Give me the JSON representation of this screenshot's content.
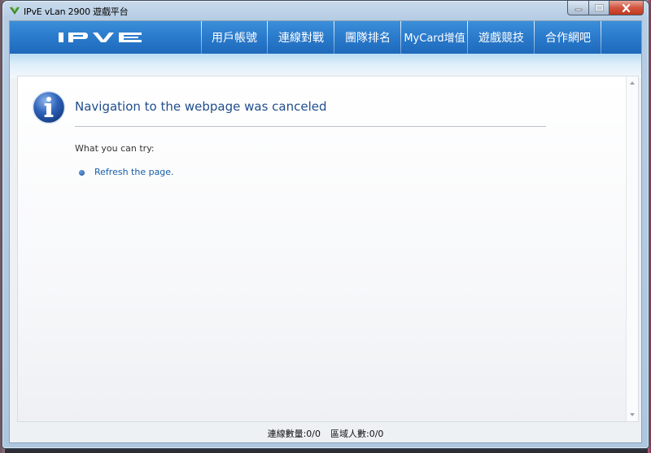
{
  "window": {
    "title": "IPvE vLan 2900 遊戲平台"
  },
  "header": {
    "logo_text": "IPVE",
    "nav": [
      {
        "label": "用戶帳號"
      },
      {
        "label": "連線對戰"
      },
      {
        "label": "團隊排名"
      },
      {
        "label": "MyCard增值"
      },
      {
        "label": "遊戲競技"
      },
      {
        "label": "合作網吧"
      }
    ]
  },
  "browser": {
    "error_title": "Navigation to the webpage was canceled",
    "try_label": "What you can try:",
    "suggestions": [
      {
        "label": "Refresh the page."
      }
    ]
  },
  "status": {
    "connections": "連線數量:0/0",
    "region_users": "區域人數:0/0"
  },
  "colors": {
    "header_blue": "#2a7acb",
    "link_blue": "#1a5ea8",
    "title_blue": "#1f4e8c",
    "close_red": "#c0391f"
  }
}
